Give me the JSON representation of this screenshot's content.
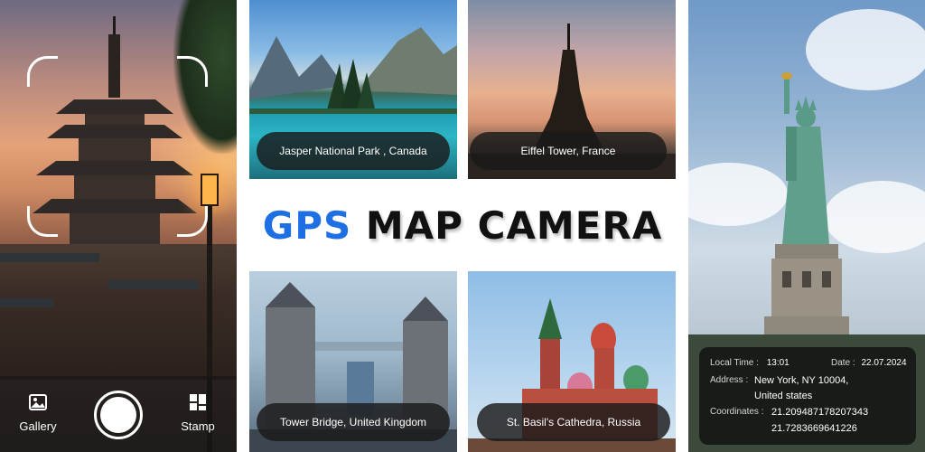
{
  "app": {
    "title_part1": "GPS",
    "title_part2": "MAP CAMERA"
  },
  "camera": {
    "gallery_label": "Gallery",
    "stamp_label": "Stamp",
    "gallery_icon": "image-icon",
    "stamp_icon": "grid-icon",
    "shutter_icon": "shutter-icon"
  },
  "tiles": [
    {
      "caption": "Jasper National Park , Canada"
    },
    {
      "caption": "Eiffel Tower, France"
    },
    {
      "caption": "Tower Bridge, United Kingdom"
    },
    {
      "caption": "St. Basil's Cathedra, Russia"
    }
  ],
  "info_card": {
    "local_time_label": "Local Time :",
    "local_time": "13:01",
    "date_label": "Date :",
    "date": "22.07.2024",
    "address_label": "Address :",
    "address_line1": "New York, NY 10004,",
    "address_line2": "United states",
    "coordinates_label": "Coordinates :",
    "latitude": "21.209487178207343",
    "longitude": "21.7283669641226"
  },
  "colors": {
    "accent": "#1e6fe3",
    "title_dark": "#111111",
    "caption_bg": "#1a1a1a"
  }
}
